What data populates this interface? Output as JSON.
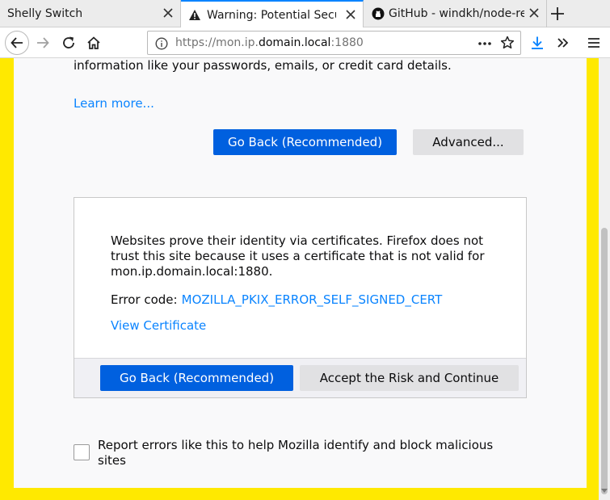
{
  "tabs": [
    {
      "title": "Shelly Switch",
      "active": false,
      "icon": null
    },
    {
      "title": "Warning: Potential Security Risk Ahead",
      "active": true,
      "icon": "warning-icon"
    },
    {
      "title": "GitHub - windkh/node-red-contrib-shelly",
      "active": false,
      "icon": "github-icon"
    }
  ],
  "navbar": {
    "url_prefix": "https://mon.ip.",
    "url_domain": "domain.local",
    "url_suffix": ":1880"
  },
  "page": {
    "intro_text": "information like your passwords, emails, or credit card details.",
    "learn_more": "Learn more...",
    "go_back_label": "Go Back (Recommended)",
    "advanced_label": "Advanced...",
    "advanced": {
      "description": "Websites prove their identity via certificates. Firefox does not trust this site because it uses a certificate that is not valid for mon.ip.domain.local:1880.",
      "error_code_label": "Error code:",
      "error_code": "MOZILLA_PKIX_ERROR_SELF_SIGNED_CERT",
      "view_certificate": "View Certificate",
      "go_back_label": "Go Back (Recommended)",
      "accept_label": "Accept the Risk and Continue"
    },
    "report_text": "Report errors like this to help Mozilla identify and block malicious sites"
  },
  "colors": {
    "accent": "#0060df",
    "link": "#0a84ff",
    "frame": "#ffe900"
  }
}
